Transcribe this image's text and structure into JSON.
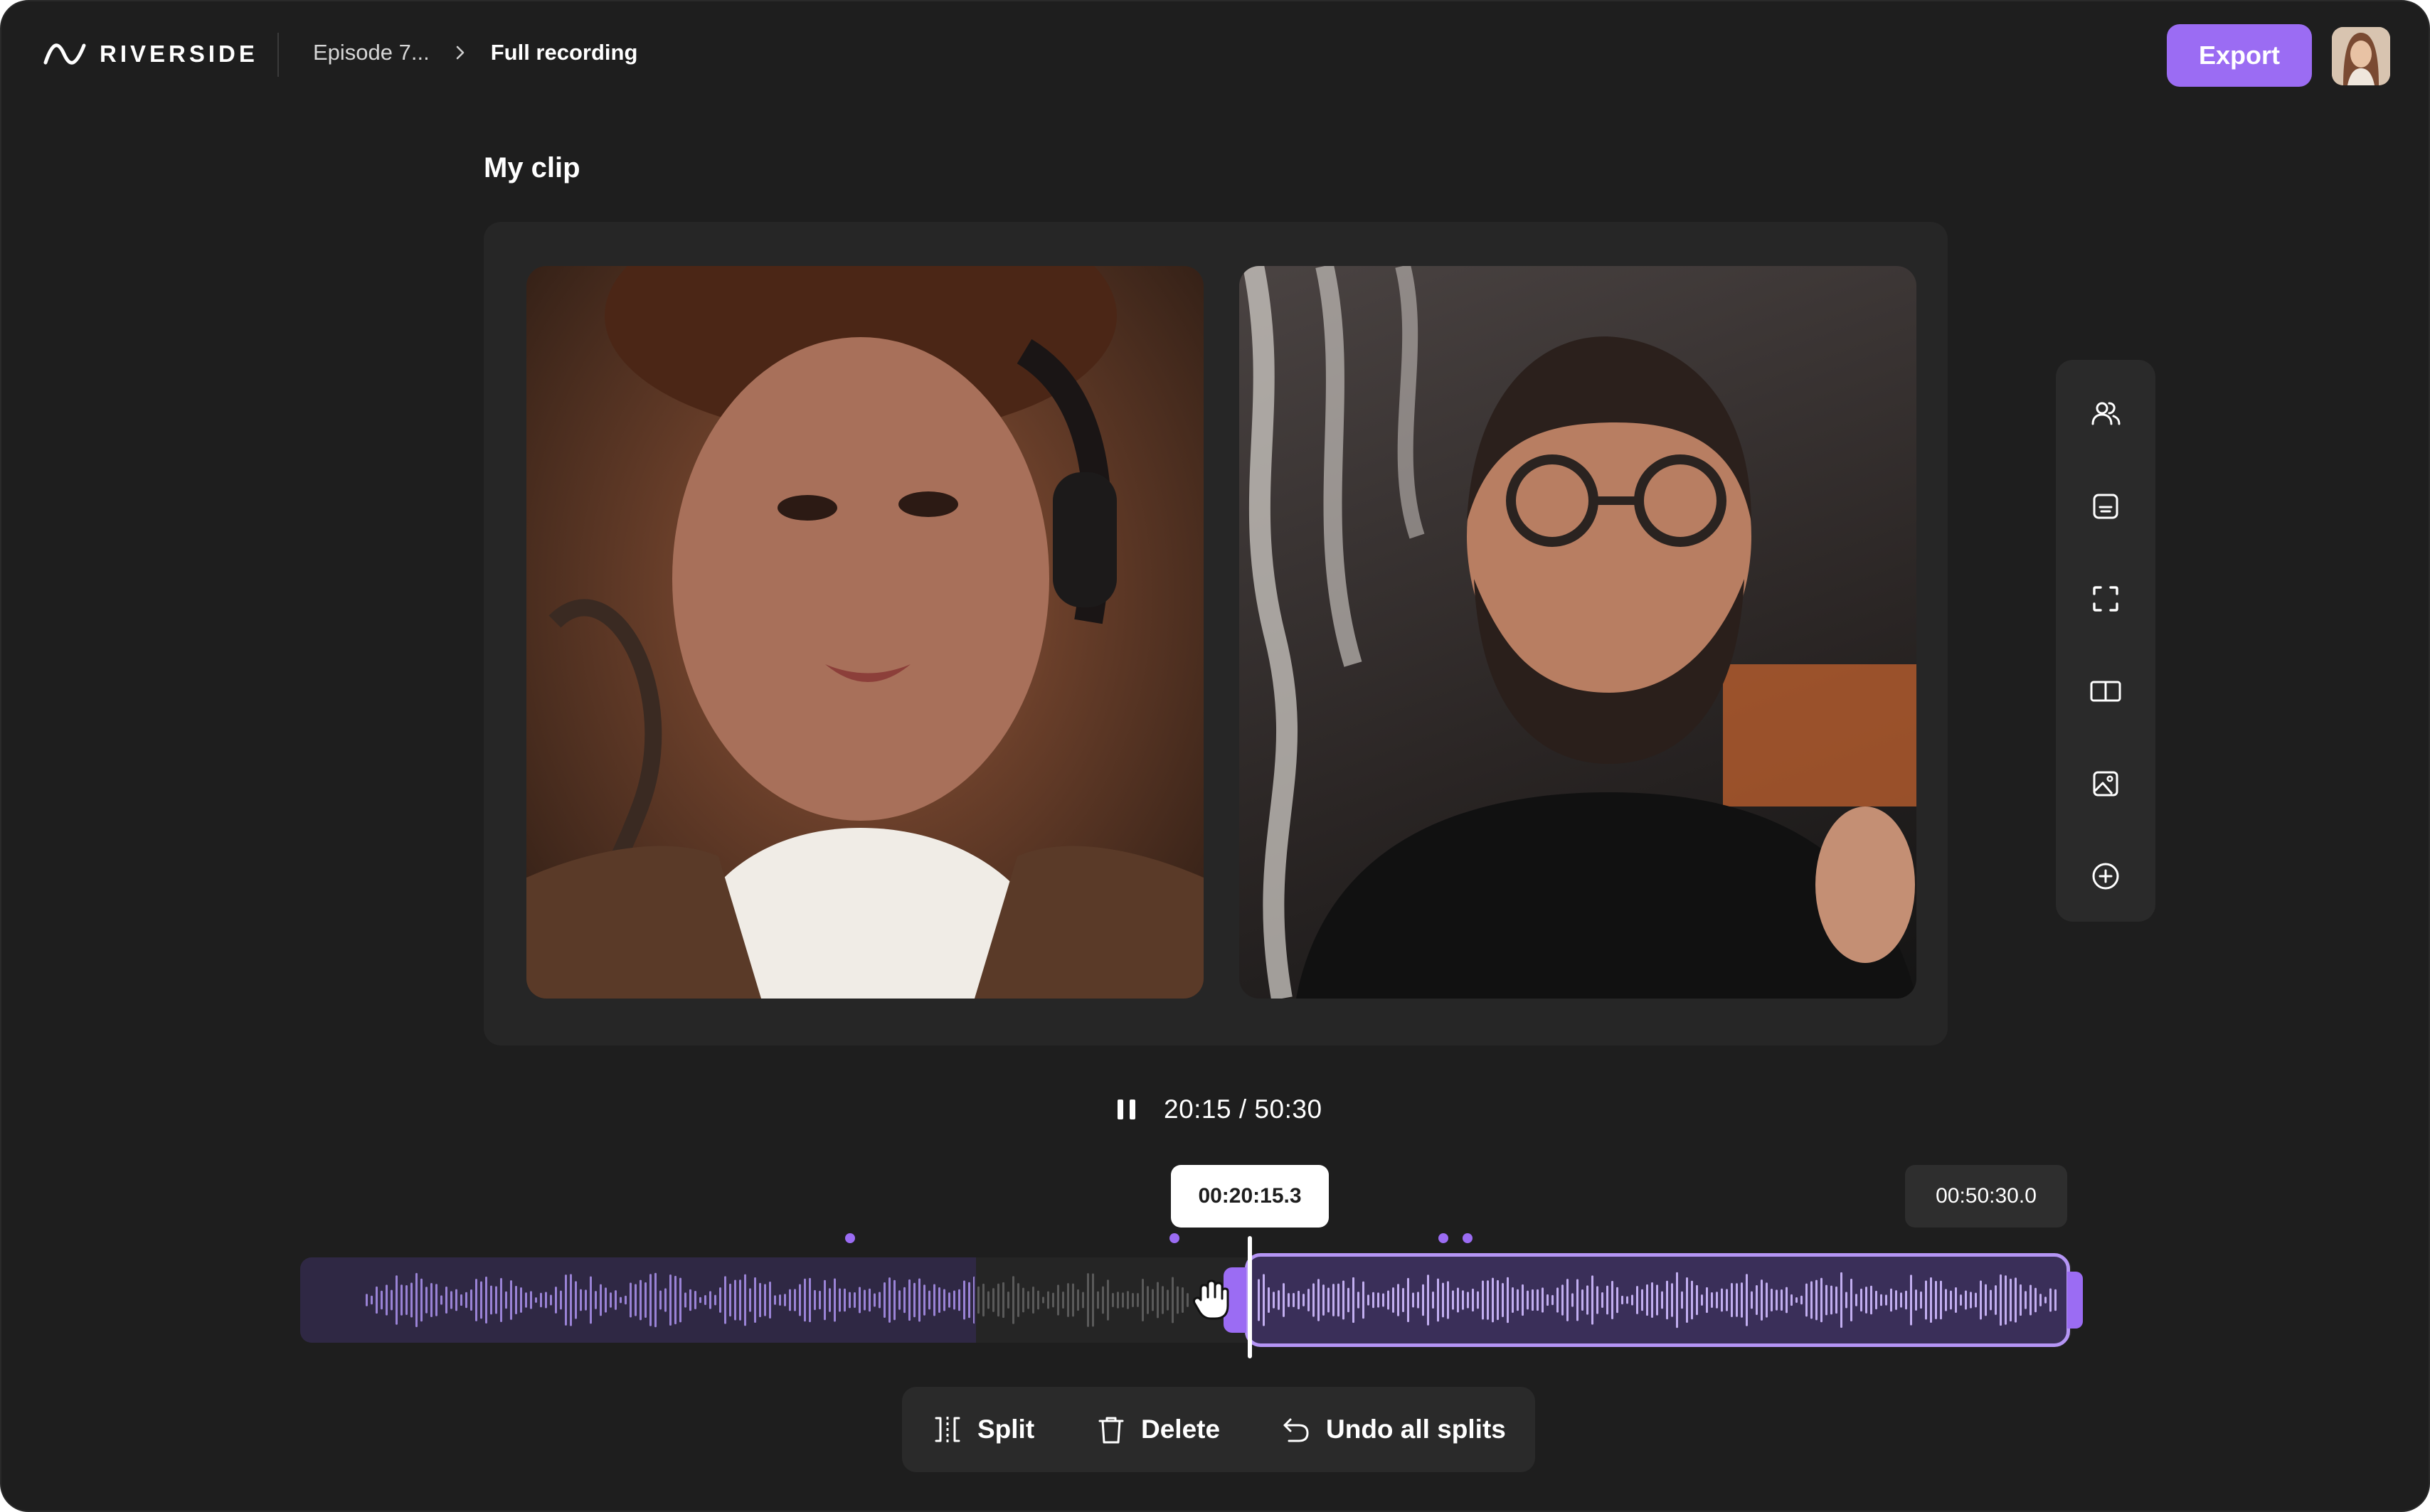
{
  "app": {
    "brand": "RIVERSIDE",
    "breadcrumb": [
      "Episode 7...",
      "Full recording"
    ]
  },
  "header": {
    "export_label": "Export"
  },
  "clip": {
    "title": "My clip"
  },
  "playback": {
    "time": "20:15 / 50:30"
  },
  "timeline": {
    "current_timestamp": "00:20:15.3",
    "end_timestamp": "00:50:30.0"
  },
  "actions": {
    "split_label": "Split",
    "delete_label": "Delete",
    "undo_label": "Undo all splits"
  },
  "tools": [
    {
      "icon": "participants-icon"
    },
    {
      "icon": "captions-icon"
    },
    {
      "icon": "fullscreen-icon"
    },
    {
      "icon": "layout-icon"
    },
    {
      "icon": "image-icon"
    },
    {
      "icon": "add-icon"
    }
  ],
  "colors": {
    "accent": "#9b6cf3",
    "background": "#1e1e1e",
    "panel": "#2a2a2a"
  }
}
